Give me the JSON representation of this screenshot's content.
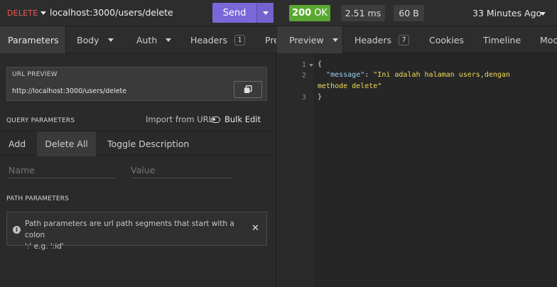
{
  "request": {
    "method": "DELETE",
    "url": "localhost:3000/users/delete",
    "send_label": "Send"
  },
  "response_meta": {
    "status_code": "200",
    "status_text": "OK",
    "time": "2.51 ms",
    "size": "60 B",
    "time_ago": "33 Minutes Ago"
  },
  "left_tabs": [
    {
      "label": "Parameters"
    },
    {
      "label": "Body"
    },
    {
      "label": "Auth"
    },
    {
      "label": "Headers",
      "badge": "1"
    },
    {
      "label": "Pre"
    }
  ],
  "url_preview": {
    "title": "URL PREVIEW",
    "value": "http://localhost:3000/users/delete"
  },
  "query_params": {
    "title": "QUERY PARAMETERS",
    "import_label": "Import from URL",
    "bulk_edit_label": "Bulk Edit",
    "actions": [
      "Add",
      "Delete All",
      "Toggle Description"
    ],
    "name_placeholder": "Name",
    "value_placeholder": "Value"
  },
  "path_params": {
    "title": "PATH PARAMETERS",
    "info_line1": "Path parameters are url path segments that start with a colon",
    "info_line2": "':' e.g. ':id'"
  },
  "right_tabs": [
    {
      "label": "Preview"
    },
    {
      "label": "Headers",
      "badge": "7"
    },
    {
      "label": "Cookies"
    },
    {
      "label": "Timeline"
    },
    {
      "label": "Moc"
    }
  ],
  "response_body": {
    "line_numbers": [
      "1",
      "2",
      "3"
    ],
    "open_brace": "{",
    "key": "\"message\"",
    "colon": ": ",
    "value_part1": "\"Ini adalah halaman users,dengan",
    "value_part2": "methode delete\"",
    "close_brace": "}"
  }
}
